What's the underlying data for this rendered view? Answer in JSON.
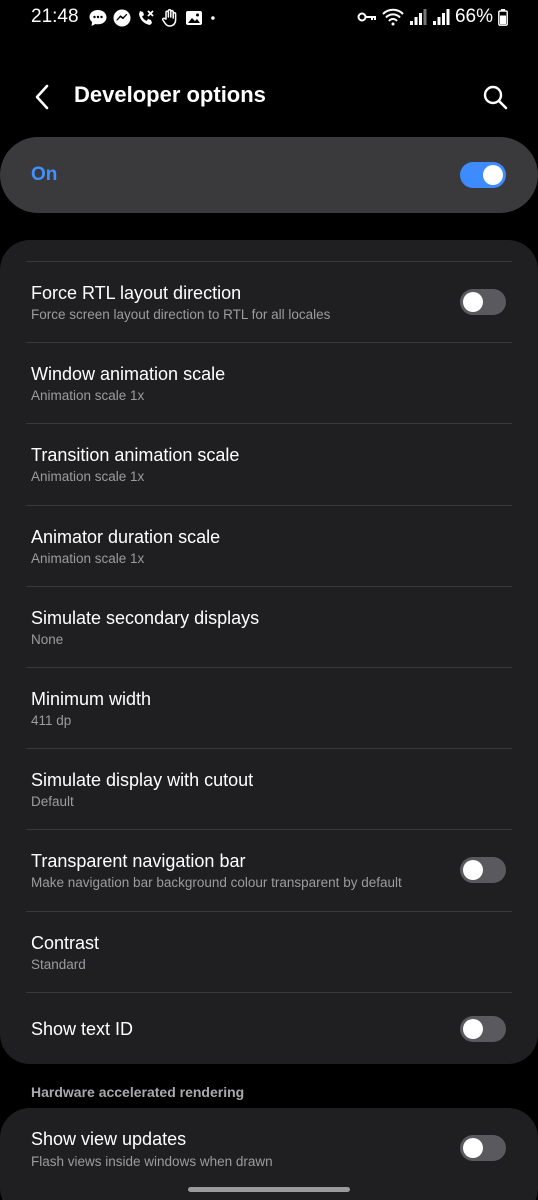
{
  "status_bar": {
    "time": "21:48",
    "left_icons": [
      "chat-bubble-icon",
      "messenger-icon",
      "phone-icon",
      "hand-icon",
      "image-icon",
      "dot-icon"
    ],
    "right_icons": [
      "key-icon",
      "wifi-icon",
      "signal-icon",
      "signal-icon",
      "battery-icon"
    ],
    "battery": "66%"
  },
  "header": {
    "title": "Developer options",
    "back_icon": "chevron-left-icon",
    "search_icon": "search-icon"
  },
  "master": {
    "label": "On",
    "enabled": true
  },
  "settings": {
    "rows": [
      {
        "title": "Force RTL layout direction",
        "subtitle": "Force screen layout direction to RTL for all locales",
        "toggle": false
      },
      {
        "title": "Window animation scale",
        "subtitle": "Animation scale 1x"
      },
      {
        "title": "Transition animation scale",
        "subtitle": "Animation scale 1x"
      },
      {
        "title": "Animator duration scale",
        "subtitle": "Animation scale 1x"
      },
      {
        "title": "Simulate secondary displays",
        "subtitle": "None"
      },
      {
        "title": "Minimum width",
        "subtitle": "411 dp"
      },
      {
        "title": "Simulate display with cutout",
        "subtitle": "Default"
      },
      {
        "title": "Transparent navigation bar",
        "subtitle": "Make navigation bar background colour transparent by default",
        "toggle": false
      },
      {
        "title": "Contrast",
        "subtitle": "Standard"
      },
      {
        "title": "Show text ID",
        "toggle": false
      }
    ]
  },
  "hardware_section": {
    "header": "Hardware accelerated rendering",
    "rows": [
      {
        "title": "Show view updates",
        "subtitle": "Flash views inside windows when drawn",
        "toggle": false
      }
    ]
  },
  "colors": {
    "accent": "#3e8bff",
    "card": "#1f1f21",
    "master_card": "#3a3a3c",
    "background": "#000000"
  }
}
